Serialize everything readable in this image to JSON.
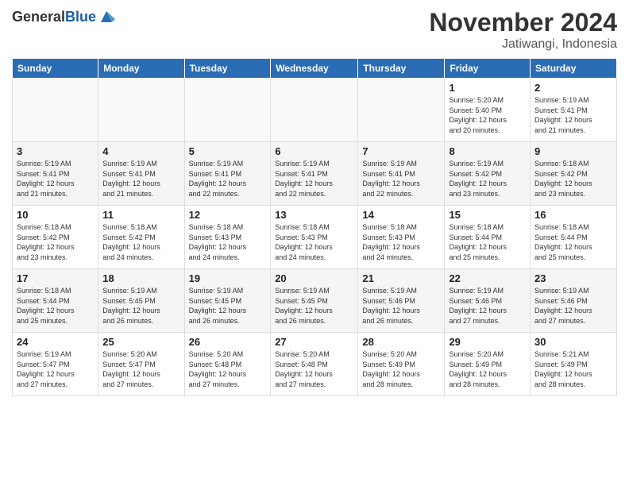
{
  "header": {
    "logo_general": "General",
    "logo_blue": "Blue",
    "month_title": "November 2024",
    "location": "Jatiwangi, Indonesia"
  },
  "columns": [
    "Sunday",
    "Monday",
    "Tuesday",
    "Wednesday",
    "Thursday",
    "Friday",
    "Saturday"
  ],
  "weeks": [
    [
      {
        "day": "",
        "empty": true
      },
      {
        "day": "",
        "empty": true
      },
      {
        "day": "",
        "empty": true
      },
      {
        "day": "",
        "empty": true
      },
      {
        "day": "",
        "empty": true
      },
      {
        "day": "1",
        "info": "Sunrise: 5:20 AM\nSunset: 5:40 PM\nDaylight: 12 hours\nand 20 minutes."
      },
      {
        "day": "2",
        "info": "Sunrise: 5:19 AM\nSunset: 5:41 PM\nDaylight: 12 hours\nand 21 minutes."
      }
    ],
    [
      {
        "day": "3",
        "info": "Sunrise: 5:19 AM\nSunset: 5:41 PM\nDaylight: 12 hours\nand 21 minutes."
      },
      {
        "day": "4",
        "info": "Sunrise: 5:19 AM\nSunset: 5:41 PM\nDaylight: 12 hours\nand 21 minutes."
      },
      {
        "day": "5",
        "info": "Sunrise: 5:19 AM\nSunset: 5:41 PM\nDaylight: 12 hours\nand 22 minutes."
      },
      {
        "day": "6",
        "info": "Sunrise: 5:19 AM\nSunset: 5:41 PM\nDaylight: 12 hours\nand 22 minutes."
      },
      {
        "day": "7",
        "info": "Sunrise: 5:19 AM\nSunset: 5:41 PM\nDaylight: 12 hours\nand 22 minutes."
      },
      {
        "day": "8",
        "info": "Sunrise: 5:19 AM\nSunset: 5:42 PM\nDaylight: 12 hours\nand 23 minutes."
      },
      {
        "day": "9",
        "info": "Sunrise: 5:18 AM\nSunset: 5:42 PM\nDaylight: 12 hours\nand 23 minutes."
      }
    ],
    [
      {
        "day": "10",
        "info": "Sunrise: 5:18 AM\nSunset: 5:42 PM\nDaylight: 12 hours\nand 23 minutes."
      },
      {
        "day": "11",
        "info": "Sunrise: 5:18 AM\nSunset: 5:42 PM\nDaylight: 12 hours\nand 24 minutes."
      },
      {
        "day": "12",
        "info": "Sunrise: 5:18 AM\nSunset: 5:43 PM\nDaylight: 12 hours\nand 24 minutes."
      },
      {
        "day": "13",
        "info": "Sunrise: 5:18 AM\nSunset: 5:43 PM\nDaylight: 12 hours\nand 24 minutes."
      },
      {
        "day": "14",
        "info": "Sunrise: 5:18 AM\nSunset: 5:43 PM\nDaylight: 12 hours\nand 24 minutes."
      },
      {
        "day": "15",
        "info": "Sunrise: 5:18 AM\nSunset: 5:44 PM\nDaylight: 12 hours\nand 25 minutes."
      },
      {
        "day": "16",
        "info": "Sunrise: 5:18 AM\nSunset: 5:44 PM\nDaylight: 12 hours\nand 25 minutes."
      }
    ],
    [
      {
        "day": "17",
        "info": "Sunrise: 5:18 AM\nSunset: 5:44 PM\nDaylight: 12 hours\nand 25 minutes."
      },
      {
        "day": "18",
        "info": "Sunrise: 5:19 AM\nSunset: 5:45 PM\nDaylight: 12 hours\nand 26 minutes."
      },
      {
        "day": "19",
        "info": "Sunrise: 5:19 AM\nSunset: 5:45 PM\nDaylight: 12 hours\nand 26 minutes."
      },
      {
        "day": "20",
        "info": "Sunrise: 5:19 AM\nSunset: 5:45 PM\nDaylight: 12 hours\nand 26 minutes."
      },
      {
        "day": "21",
        "info": "Sunrise: 5:19 AM\nSunset: 5:46 PM\nDaylight: 12 hours\nand 26 minutes."
      },
      {
        "day": "22",
        "info": "Sunrise: 5:19 AM\nSunset: 5:46 PM\nDaylight: 12 hours\nand 27 minutes."
      },
      {
        "day": "23",
        "info": "Sunrise: 5:19 AM\nSunset: 5:46 PM\nDaylight: 12 hours\nand 27 minutes."
      }
    ],
    [
      {
        "day": "24",
        "info": "Sunrise: 5:19 AM\nSunset: 5:47 PM\nDaylight: 12 hours\nand 27 minutes."
      },
      {
        "day": "25",
        "info": "Sunrise: 5:20 AM\nSunset: 5:47 PM\nDaylight: 12 hours\nand 27 minutes."
      },
      {
        "day": "26",
        "info": "Sunrise: 5:20 AM\nSunset: 5:48 PM\nDaylight: 12 hours\nand 27 minutes."
      },
      {
        "day": "27",
        "info": "Sunrise: 5:20 AM\nSunset: 5:48 PM\nDaylight: 12 hours\nand 27 minutes."
      },
      {
        "day": "28",
        "info": "Sunrise: 5:20 AM\nSunset: 5:49 PM\nDaylight: 12 hours\nand 28 minutes."
      },
      {
        "day": "29",
        "info": "Sunrise: 5:20 AM\nSunset: 5:49 PM\nDaylight: 12 hours\nand 28 minutes."
      },
      {
        "day": "30",
        "info": "Sunrise: 5:21 AM\nSunset: 5:49 PM\nDaylight: 12 hours\nand 28 minutes."
      }
    ]
  ]
}
